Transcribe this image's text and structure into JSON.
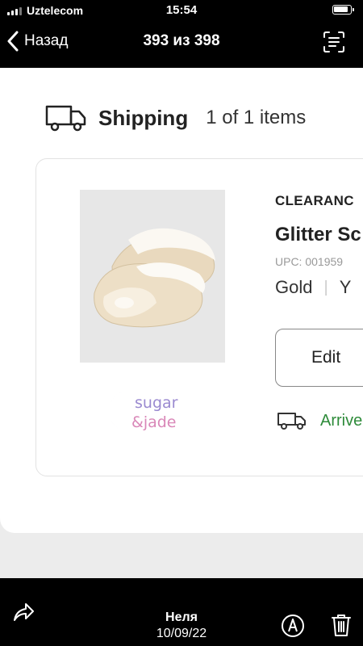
{
  "status_bar": {
    "carrier": "Uztelecom",
    "time": "15:54"
  },
  "nav": {
    "back_label": "Назад",
    "title": "393 из 398"
  },
  "shipping": {
    "title": "Shipping",
    "count": "1 of 1 items"
  },
  "item": {
    "badge": "CLEARANC",
    "name": "Glitter Sc",
    "upc": "UPC: 001959",
    "color": "Gold",
    "size": "Y",
    "edit_label": "Edit",
    "delivery_text": "Arrive"
  },
  "brand": {
    "line1": "sugar",
    "line2": "&jade"
  },
  "toolbar": {
    "sender": "Неля",
    "date": "10/09/22"
  },
  "colors": {
    "delivery_green": "#2e8b3a",
    "background": "#000000",
    "panel": "#ffffff"
  }
}
